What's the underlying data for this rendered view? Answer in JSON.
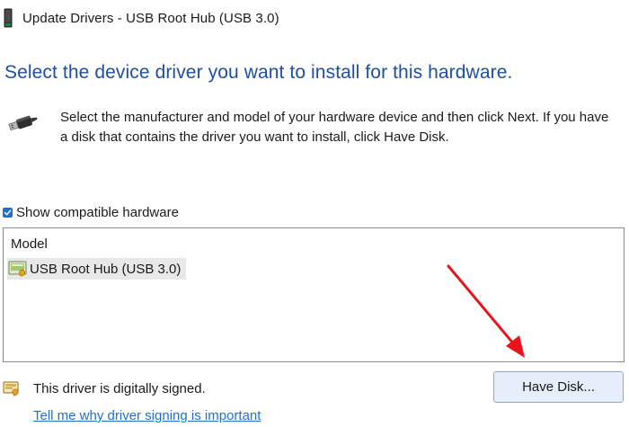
{
  "window": {
    "title": "Update Drivers - USB Root Hub (USB 3.0)",
    "icon": "device-manager-icon"
  },
  "heading": "Select the device driver you want to install for this hardware.",
  "description": {
    "icon": "usb-plug-icon",
    "text": "Select the manufacturer and model of your hardware device and then click Next. If you have a disk that contains the driver you want to install, click Have Disk."
  },
  "compatible_checkbox": {
    "label": "Show compatible hardware",
    "checked": true
  },
  "model_list": {
    "header": "Model",
    "items": [
      {
        "label": "USB Root Hub (USB 3.0)",
        "icon": "driver-certificate-icon",
        "selected": true
      }
    ]
  },
  "signature": {
    "icon": "signed-driver-icon",
    "text": "This driver is digitally signed.",
    "link": "Tell me why driver signing is important"
  },
  "buttons": {
    "have_disk": "Have Disk..."
  },
  "colors": {
    "heading": "#1f4fa0",
    "link": "#1f6fcf",
    "checkbox": "#1f6fcf",
    "selected_item_bg": "#e8e8e8",
    "button_bg": "#e6eef9",
    "annotation_arrow": "#e8141c"
  }
}
